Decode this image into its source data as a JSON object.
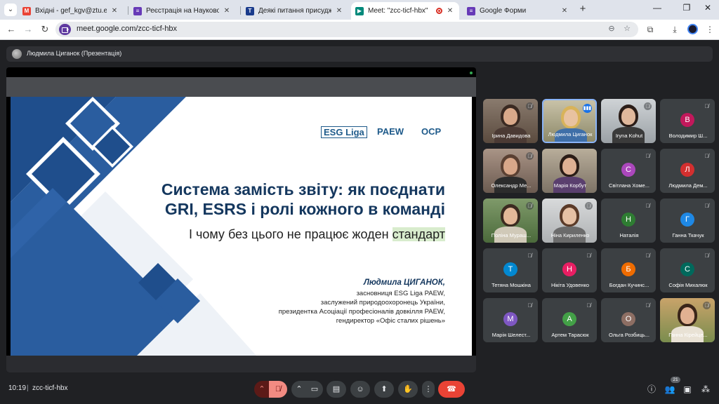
{
  "browser": {
    "tabs": [
      {
        "title": "Вхідні - gef_kgv@ztu.edu.ua - Пош",
        "favicon": "gmail-icon",
        "color": "#ea4335",
        "glyph": "M"
      },
      {
        "title": "Реєстрація на Науково-практич",
        "favicon": "forms-icon",
        "color": "#673ab7",
        "glyph": "≡"
      },
      {
        "title": "Деякі питання присудження сту",
        "favicon": "gov-icon",
        "color": "#1a3b8c",
        "glyph": "Т"
      },
      {
        "title": "Meet: \"zcc-ticf-hbx\"",
        "favicon": "meet-icon",
        "color": "#00897b",
        "glyph": "▶"
      },
      {
        "title": "Google Форми",
        "favicon": "forms-icon",
        "color": "#673ab7",
        "glyph": "≡"
      }
    ],
    "url": "meet.google.com/zcc-ticf-hbx"
  },
  "presenter": {
    "name": "Людмила Циганок (Презентація)"
  },
  "slide": {
    "brands": [
      "ESG Liga",
      "PAEW",
      "OCP"
    ],
    "title_line1": "Система замість звіту: як поєднати",
    "title_line2": "GRI, ESRS і ролі кожного в команді",
    "subtitle_main": "І чому без цього не працює жоден ",
    "subtitle_highlight": "стандарт",
    "author": "Людмила ЦИГАНОК,",
    "author_lines": [
      "засновниця ESG Liga PAEW,",
      "заслужений природоохоронець України,",
      "президентка Асоціації професіоналів довкілля PAEW,",
      "гендиректор «Офіс сталих рішень»"
    ]
  },
  "participants": [
    {
      "name": "Ірина Давидова",
      "video": true,
      "muted": true,
      "scene": "woman-dark"
    },
    {
      "name": "Людмила Циганок",
      "video": true,
      "muted": false,
      "speaking": true,
      "scene": "woman-blonde"
    },
    {
      "name": "Iryna Kohut",
      "video": true,
      "muted": true,
      "scene": "woman-dark2"
    },
    {
      "name": "Володимир Ш...",
      "initial": "В",
      "color": "#c2185b",
      "muted": true
    },
    {
      "name": "Олександр Ме...",
      "video": true,
      "muted": true,
      "scene": "man"
    },
    {
      "name": "Марія Корбут",
      "video": true,
      "muted": false,
      "scene": "woman-room"
    },
    {
      "name": "Світлана Хоме...",
      "initial": "С",
      "color": "#ab47bc",
      "muted": true
    },
    {
      "name": "Людмила Дем...",
      "initial": "Л",
      "color": "#d32f2f",
      "muted": true
    },
    {
      "name": "Поліна Мураш...",
      "video": true,
      "muted": true,
      "scene": "woman-green"
    },
    {
      "name": "Ніна Кириленко",
      "video": true,
      "muted": true,
      "scene": "woman-office"
    },
    {
      "name": "Наталія",
      "initial": "Н",
      "color": "#2e7d32",
      "muted": true
    },
    {
      "name": "Ганна Ткачук",
      "initial": "Г",
      "color": "#1e88e5",
      "muted": true
    },
    {
      "name": "Тетяна Мошкіна",
      "initial": "Т",
      "color": "#0288d1",
      "muted": true
    },
    {
      "name": "Нікіта Удовенко",
      "initial": "Н",
      "color": "#e91e63",
      "muted": true
    },
    {
      "name": "Богдан Кучинс...",
      "initial": "Б",
      "color": "#ef6c00",
      "muted": true
    },
    {
      "name": "Софія Михалюк",
      "initial": "С",
      "color": "#00695c",
      "muted": true
    },
    {
      "name": "Марія Шелест...",
      "initial": "М",
      "color": "#7e57c2",
      "muted": true
    },
    {
      "name": "Артем Тарасюк",
      "initial": "А",
      "color": "#43a047",
      "muted": true
    },
    {
      "name": "Ольга Розбиць...",
      "initial": "О",
      "color": "#8d6e63",
      "muted": true
    },
    {
      "name": "Ганна Кірейце...",
      "video": true,
      "muted": true,
      "scene": "woman-flowers"
    }
  ],
  "controls": {
    "time": "10:19",
    "separator": "|",
    "meeting_code": "zcc-ticf-hbx",
    "participant_count": "21"
  }
}
